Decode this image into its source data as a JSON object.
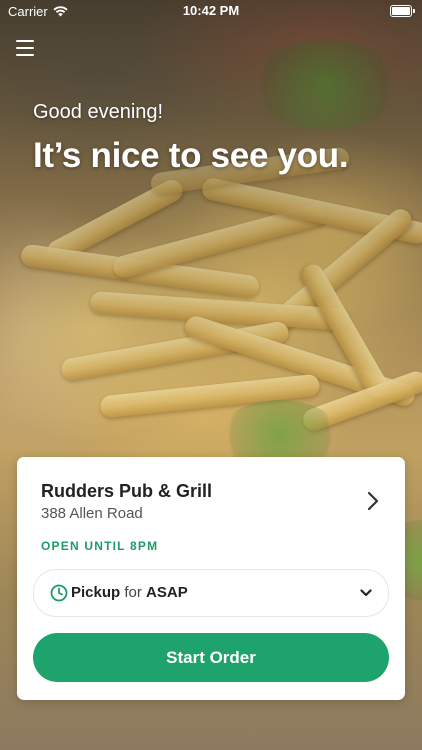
{
  "status_bar": {
    "carrier": "Carrier",
    "time": "10:42 PM",
    "wifi_icon": "wifi-icon",
    "battery_icon": "battery-icon"
  },
  "nav": {
    "menu_icon": "hamburger-menu-icon"
  },
  "hero": {
    "greeting": "Good evening!",
    "headline": "It’s nice to see you."
  },
  "store": {
    "name": "Rudders Pub & Grill",
    "address": "388 Allen Road",
    "status": "OPEN UNTIL 8PM",
    "detail_icon": "chevron-right-icon"
  },
  "order": {
    "mode": "Pickup",
    "for_text": "for",
    "time": "ASAP",
    "clock_icon": "clock-icon",
    "dropdown_icon": "chevron-down-icon",
    "start_label": "Start Order"
  },
  "colors": {
    "brand_green": "#1fa36c",
    "status_green": "#1e9c67"
  }
}
